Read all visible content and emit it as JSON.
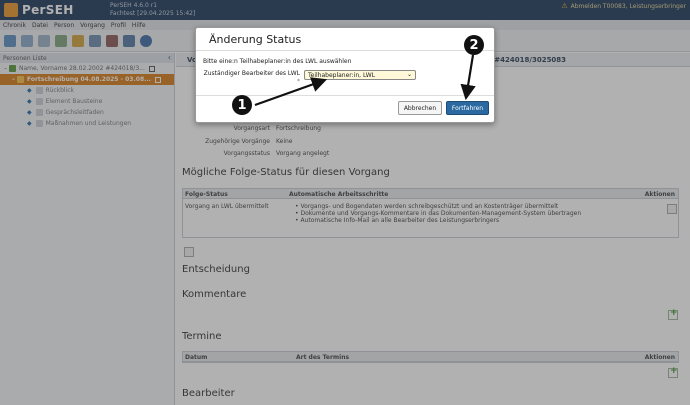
{
  "app": {
    "name": "PerSEH",
    "version": "PerSEH 4.6.0 r1",
    "date_line": "Fachtest [29.04.2025 15:42]",
    "user": "Abmelden T00083, Leistungserbringer"
  },
  "menu": [
    "Chronik",
    "Datei",
    "Person",
    "Vorgang",
    "Profil",
    "Hilfe"
  ],
  "sidebar": {
    "title": "Personen Liste",
    "tree": [
      {
        "label": "Name, Vorname 28.02.2002 #424018/3..."
      },
      {
        "label": "Fortschreibung 04.08.2025 - 03.08..."
      }
    ],
    "items": [
      "Rückblick",
      "Element Bausteine",
      "Gesprächsleitfaden",
      "Maßnahmen und Leistungen"
    ]
  },
  "main": {
    "header_left": "Vo",
    "header_right": "0 #424018/3025083",
    "fields": [
      {
        "key": "Vorgangsart",
        "value": "Fortschreibung"
      },
      {
        "key": "Zugehörige Vorgänge",
        "value": "Keine"
      },
      {
        "key": "Vorgangsstatus",
        "value": "Vorgang angelegt"
      }
    ],
    "next_status": {
      "title": "Mögliche Folge-Status für diesen Vorgang",
      "columns": [
        "Folge-Status",
        "Automatische Arbeitsschritte",
        "Aktionen"
      ],
      "row_status": "Vorgang an LWL übermittelt",
      "steps": [
        "Vorgangs- und Bogendaten werden schreibgeschützt und an Kostenträger übermittelt",
        "Dokumente und Vorgangs-Kommentare in das Dokumenten-Management-System übertragen",
        "Automatische Info-Mail an alle Bearbeiter des Leistungserbringers"
      ]
    },
    "sections": [
      "Entscheidung",
      "Kommentare",
      "Termine",
      "Bearbeiter"
    ],
    "termine_columns": [
      "Datum",
      "Art des Termins",
      "Aktionen"
    ]
  },
  "dialog": {
    "title": "Änderung Status",
    "instruction": "Bitte eine:n Teilhabeplaner:in des LWL auswählen",
    "field_label": "Zuständiger Bearbeiter des LWL",
    "required_mark": "*",
    "selected": "Teilhabeplaner:in, LWL",
    "cancel": "Abbrechen",
    "confirm": "Fortfahren"
  },
  "annotations": [
    "1",
    "2"
  ],
  "colors": {
    "topbar": "#1e3a5c",
    "active_node": "#d77d1a",
    "primary_button": "#2a6aa0",
    "select_bg": "#fff9d9"
  }
}
